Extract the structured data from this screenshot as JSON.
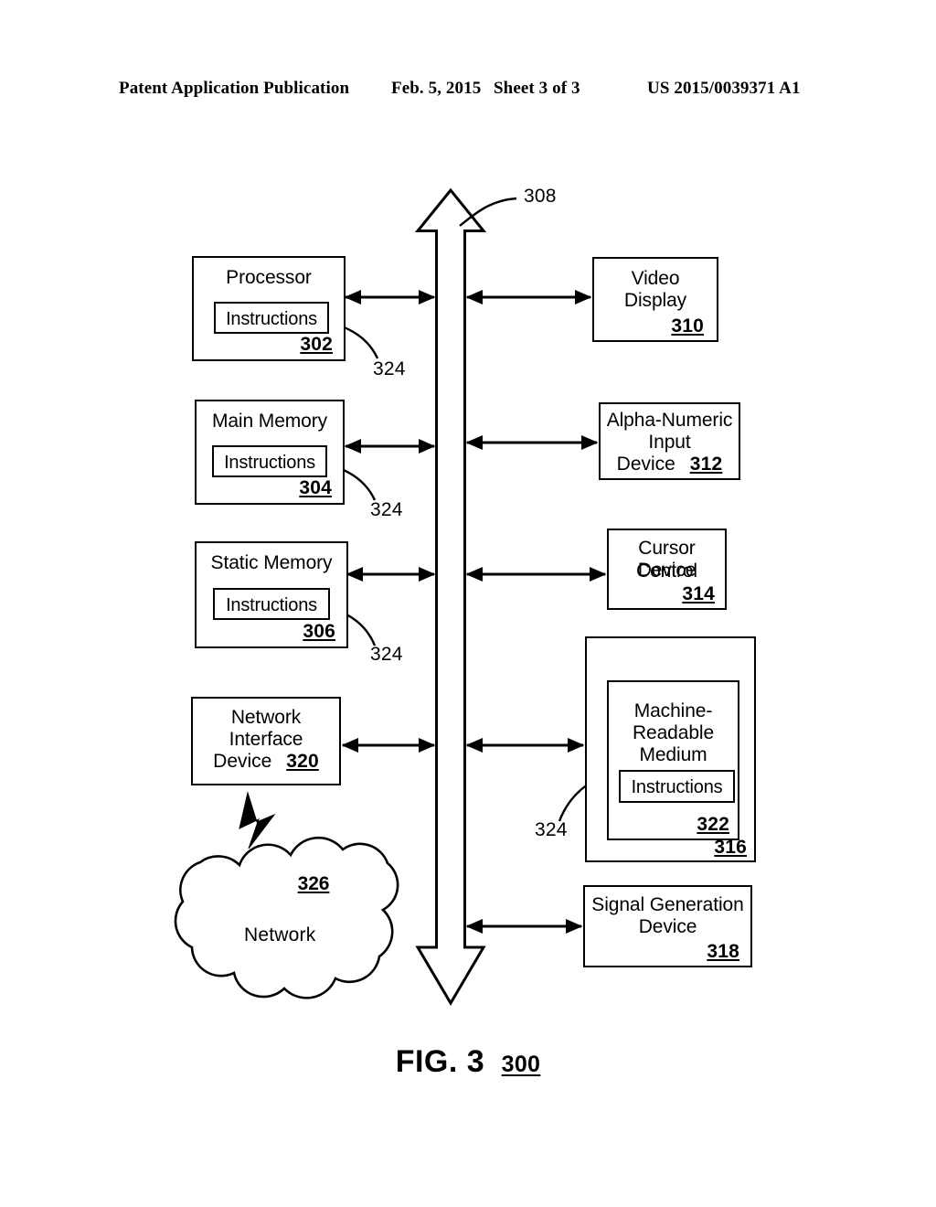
{
  "header": {
    "publication": "Patent Application Publication",
    "date": "Feb. 5, 2015",
    "sheet": "Sheet 3 of 3",
    "document_number": "US 2015/0039371 A1"
  },
  "figure": {
    "caption": "FIG. 3",
    "caption_ref": "300",
    "bus_ref": "308"
  },
  "left_column": [
    {
      "title": "Processor",
      "inner_label": "Instructions",
      "ref": "302",
      "leader_ref": "324"
    },
    {
      "title": "Main Memory",
      "inner_label": "Instructions",
      "ref": "304",
      "leader_ref": "324"
    },
    {
      "title": "Static Memory",
      "inner_label": "Instructions",
      "ref": "306",
      "leader_ref": "324"
    },
    {
      "title_line1": "Network",
      "title_line2": "Interface",
      "title_line3": "Device",
      "ref": "320"
    }
  ],
  "right_column": [
    {
      "title_line1": "Video",
      "title_line2": "Display",
      "ref": "310"
    },
    {
      "title_line1": "Alpha-Numeric",
      "title_line2": "Input",
      "title_line3": "Device",
      "ref": "312"
    },
    {
      "title_line1": "Cursor Control",
      "title_line2": "Device",
      "ref": "314"
    },
    {
      "outer_ref": "316",
      "title_line1": "Machine-",
      "title_line2": "Readable",
      "title_line3": "Medium",
      "inner_label": "Instructions",
      "inner_ref": "322",
      "leader_ref": "324"
    },
    {
      "title_line1": "Signal Generation",
      "title_line2": "Device",
      "ref": "318"
    }
  ],
  "network": {
    "label": "Network",
    "ref": "326"
  },
  "colors": {
    "ink": "#000000",
    "paper": "#ffffff"
  }
}
